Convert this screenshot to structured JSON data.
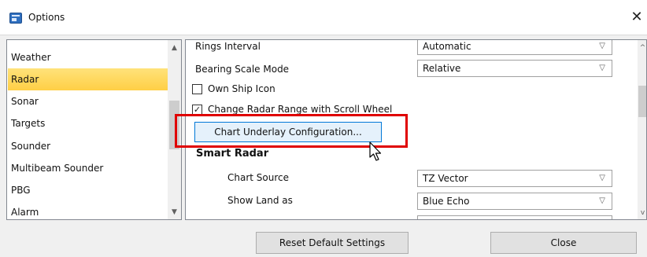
{
  "window": {
    "title": "Options",
    "close_glyph": "✕"
  },
  "left_nav": {
    "items": [
      {
        "label": "Weather"
      },
      {
        "label": "Radar"
      },
      {
        "label": "Sonar"
      },
      {
        "label": "Targets"
      },
      {
        "label": "Sounder"
      },
      {
        "label": "Multibeam Sounder"
      },
      {
        "label": "PBG"
      },
      {
        "label": "Alarm"
      }
    ],
    "selected": "Radar"
  },
  "settings": {
    "rings_interval": {
      "label": "Rings Interval",
      "value": "Automatic"
    },
    "bearing_scale_mode": {
      "label": "Bearing Scale Mode",
      "value": "Relative"
    },
    "own_ship_icon": {
      "label": "Own Ship Icon",
      "checked": false
    },
    "change_range_scroll": {
      "label": "Change Radar Range with Scroll Wheel",
      "checked": true,
      "check_glyph": "✓"
    },
    "chart_underlay_button": "Chart Underlay Configuration...",
    "smart_radar_heading": "Smart Radar",
    "chart_source": {
      "label": "Chart Source",
      "value": "TZ Vector"
    },
    "show_land_as": {
      "label": "Show Land as",
      "value": "Blue Echo"
    }
  },
  "footer": {
    "reset_label": "Reset Default Settings",
    "close_label": "Close"
  },
  "colors": {
    "selection": "#ffd866",
    "highlight_border": "#e00000",
    "button_focus": "#0078d7"
  },
  "icons": [
    "options-app-icon",
    "close-icon",
    "scroll-up-icon",
    "scroll-down-icon",
    "chevron-down-icon",
    "mouse-pointer-icon"
  ]
}
